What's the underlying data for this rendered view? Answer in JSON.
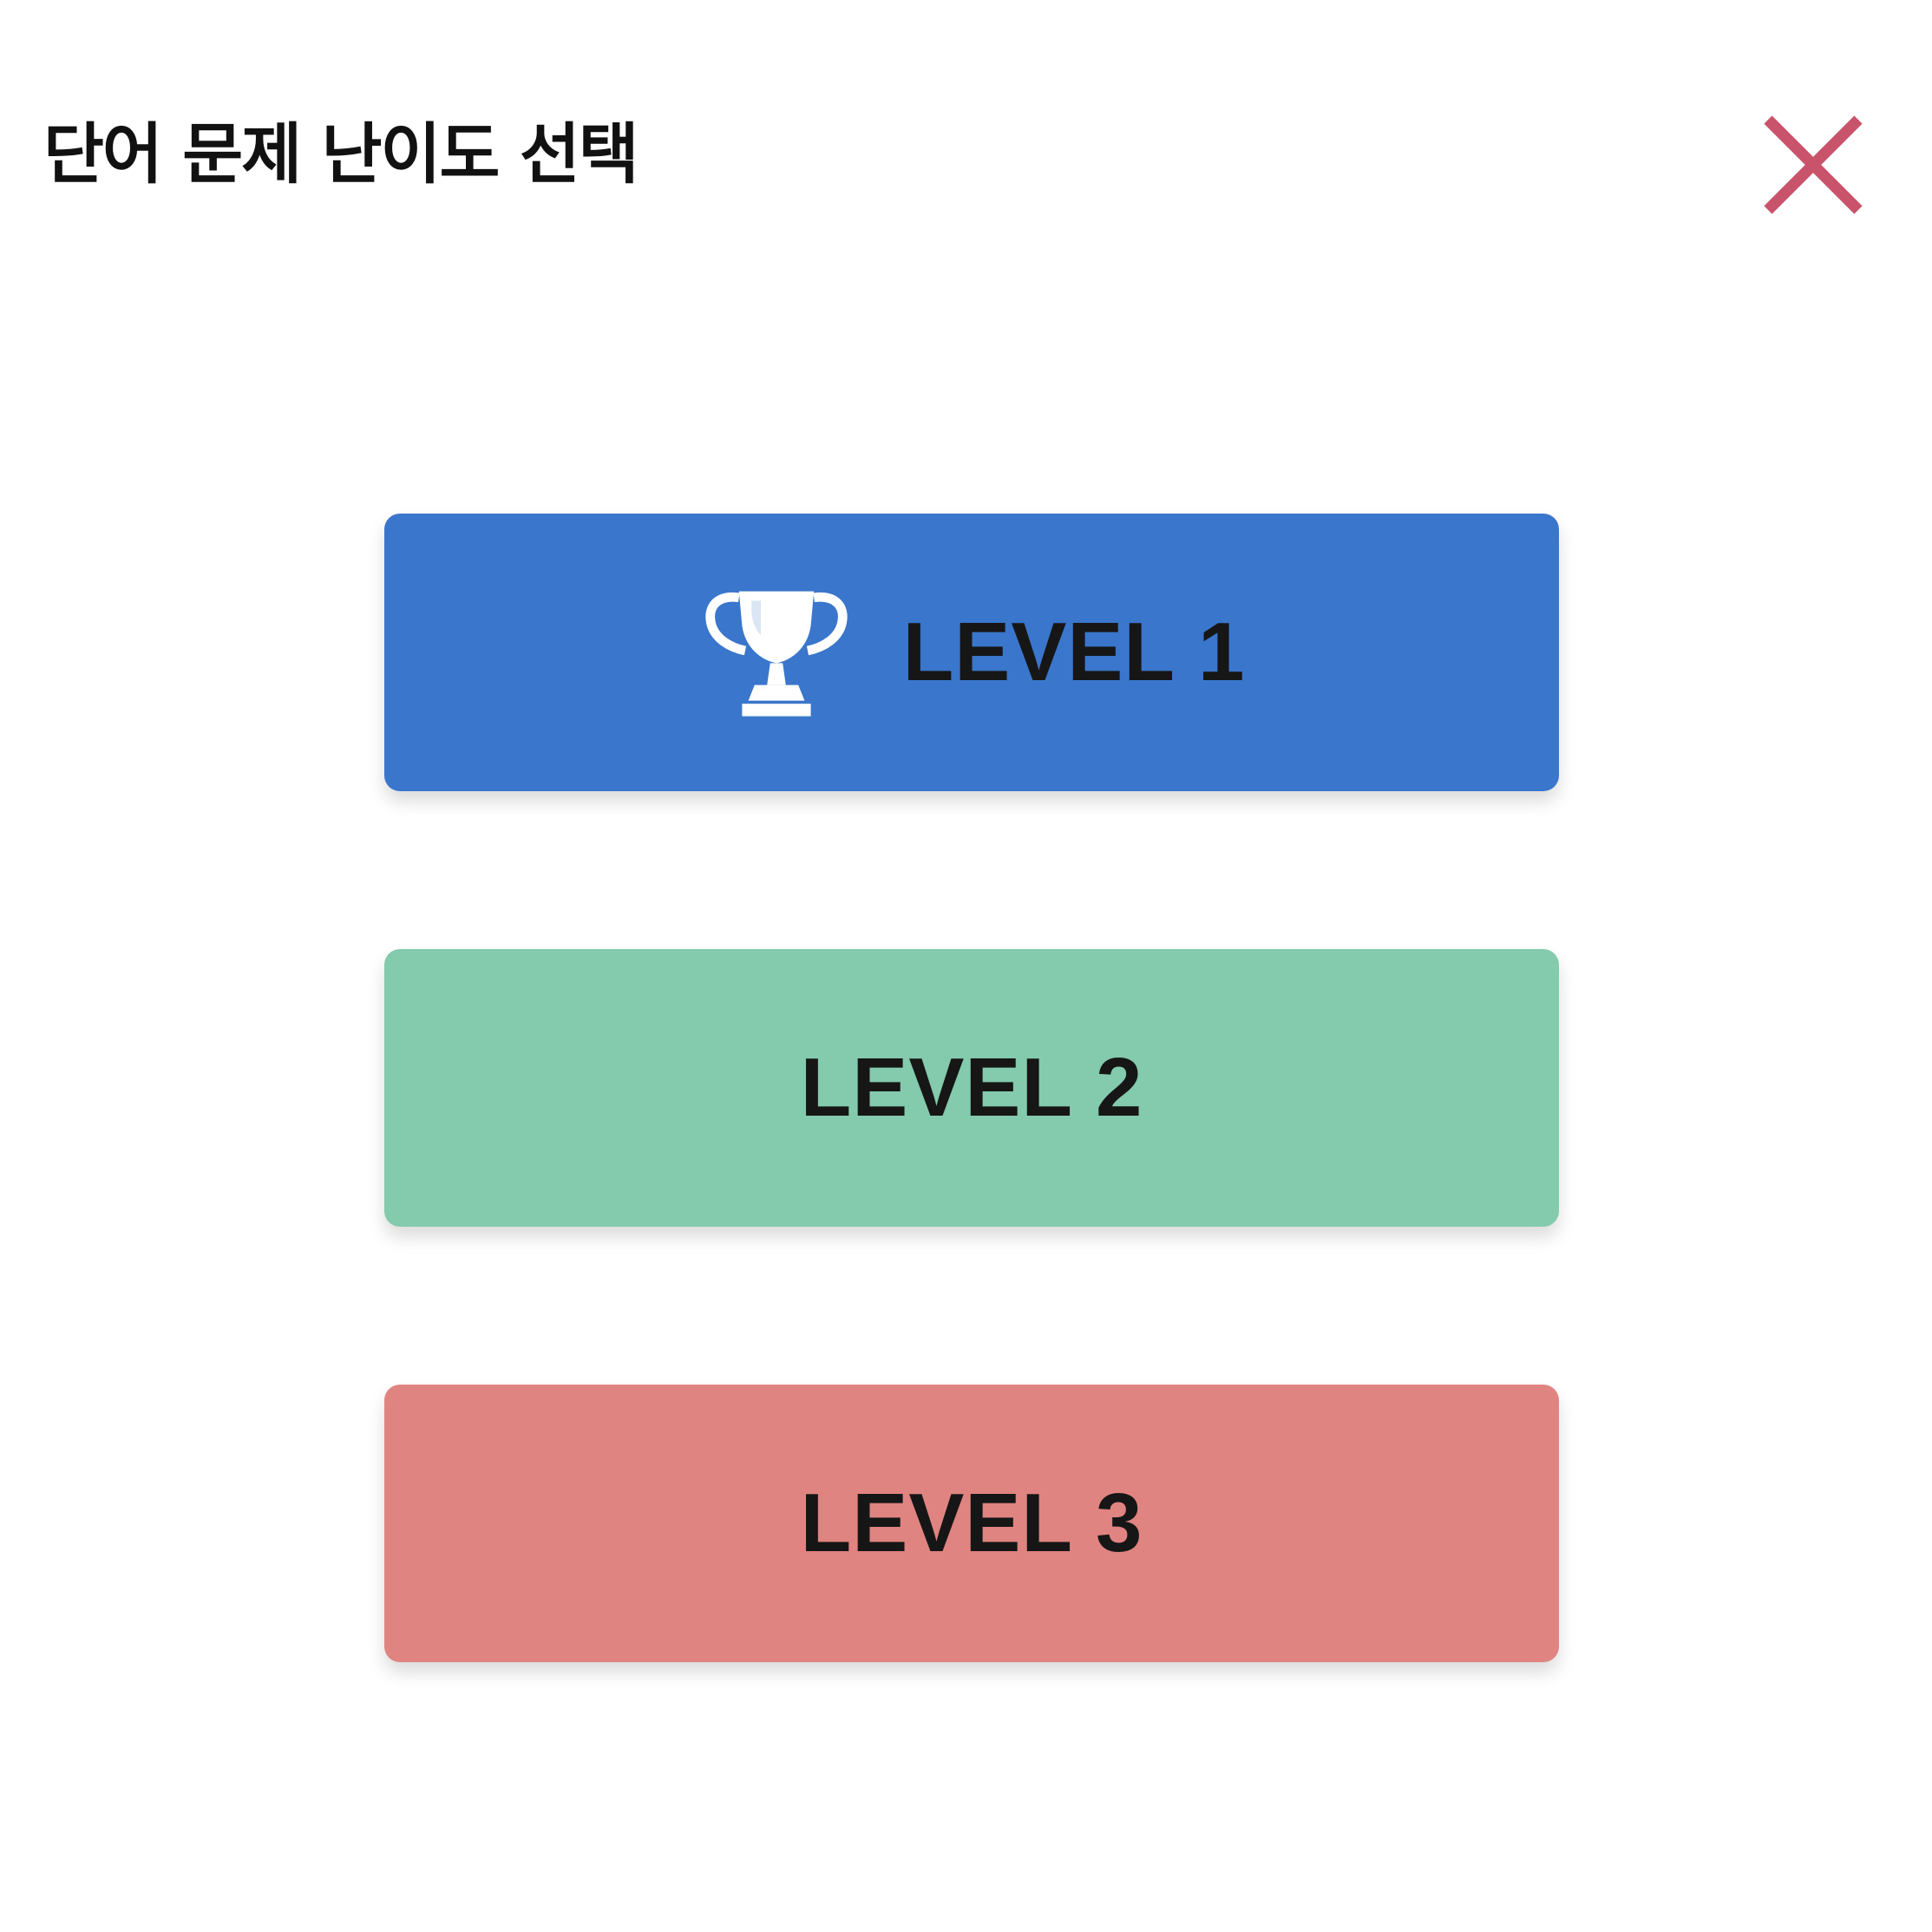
{
  "modal": {
    "title": "단어 문제 난이도 선택",
    "close_icon": "close-icon",
    "close_color": "#C9536A"
  },
  "levels": [
    {
      "label": "LEVEL 1",
      "color": "#3A76CB",
      "icon": "trophy-icon",
      "selected": true
    },
    {
      "label": "LEVEL 2",
      "color": "#84CAAD",
      "icon": null,
      "selected": false
    },
    {
      "label": "LEVEL 3",
      "color": "#E08481",
      "icon": null,
      "selected": false
    }
  ]
}
